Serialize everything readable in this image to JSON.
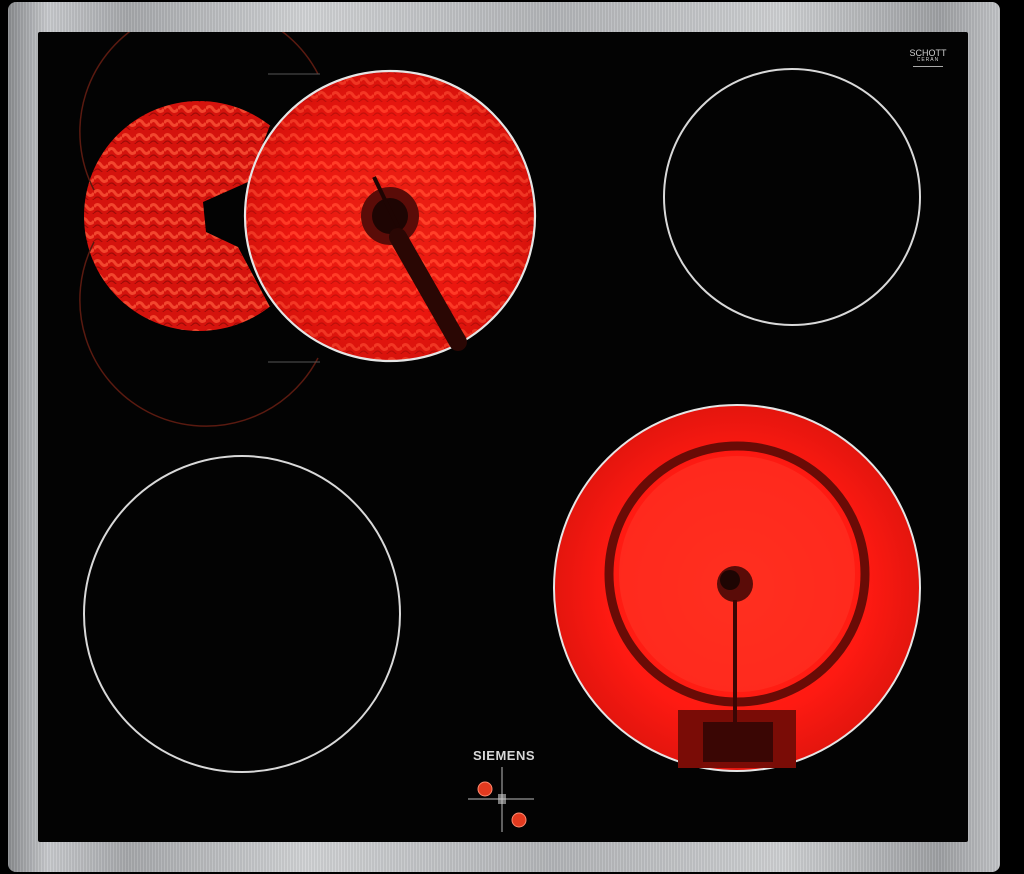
{
  "appliance": {
    "brand": "SIEMENS",
    "model_label": "",
    "cert_mark": {
      "title": "SCHOTT",
      "subtitle": "CERAN"
    }
  },
  "colors": {
    "glass": "#030303",
    "heat_red": "#ff1a12",
    "heat_dark": "#7a0c06",
    "zone_outline": "#d9d9d9",
    "frame_steel": "#b8babd"
  },
  "zones": [
    {
      "name": "front-left-zone",
      "state": "off"
    },
    {
      "name": "front-right-zone",
      "state": "on"
    },
    {
      "name": "back-left-zone",
      "state": "on",
      "extended": true
    },
    {
      "name": "back-right-zone",
      "state": "off"
    }
  ],
  "indicators": [
    {
      "name": "indicator-light-top",
      "state": "on"
    },
    {
      "name": "indicator-light-bottom",
      "state": "on"
    }
  ]
}
